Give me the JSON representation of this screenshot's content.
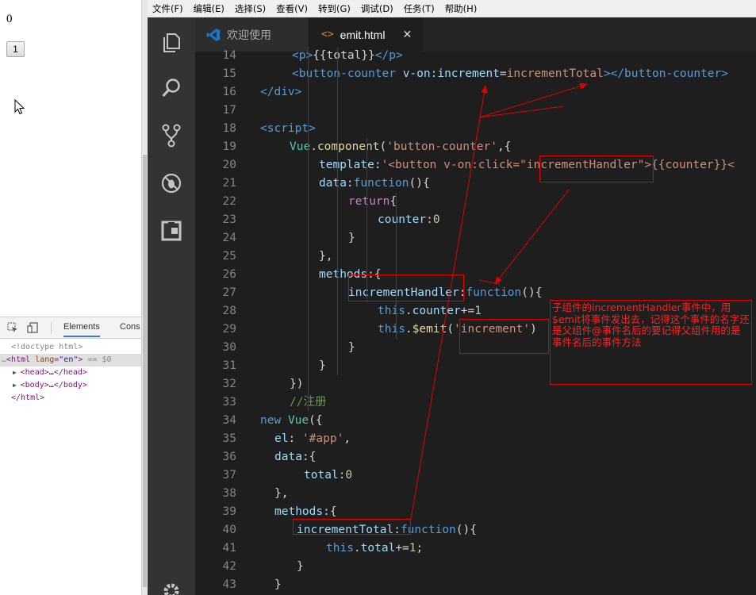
{
  "browser": {
    "total": "0",
    "counter_button": "1"
  },
  "devtools": {
    "tabs": [
      "Elements",
      "Cons"
    ],
    "lines": [
      {
        "text": "<!doctype html>"
      },
      {
        "text": "<html lang=\"en\"> == $0"
      },
      {
        "text": "<head>…</head>"
      },
      {
        "text": "<body>…</body>"
      },
      {
        "text": "</html>"
      }
    ]
  },
  "editor": {
    "menu": [
      "文件(F)",
      "编辑(E)",
      "选择(S)",
      "查看(V)",
      "转到(G)",
      "调试(D)",
      "任务(T)",
      "帮助(H)"
    ],
    "tabs": {
      "welcome": "欢迎使用",
      "emit": "emit.html",
      "close": "✕"
    },
    "activity_icons": [
      "explorer-icon",
      "search-icon",
      "source-control-icon",
      "debug-icon",
      "extensions-icon",
      "gear-icon"
    ],
    "line_numbers": [
      "14",
      "15",
      "16",
      "17",
      "18",
      "19",
      "20",
      "21",
      "22",
      "23",
      "24",
      "25",
      "26",
      "27",
      "28",
      "29",
      "30",
      "31",
      "32",
      "33",
      "34",
      "35",
      "36",
      "37",
      "38",
      "39",
      "40",
      "41",
      "42",
      "43"
    ],
    "code": {
      "l14": [
        "<p>",
        "{{total}}",
        "</p>"
      ],
      "l15": [
        "<button-counter ",
        "v-on:increment",
        "=",
        "incrementTotal",
        "></button-counter>"
      ],
      "l16": [
        "</div>"
      ],
      "l18": [
        "<script>"
      ],
      "l19": [
        "Vue",
        ".",
        "component",
        "(",
        "'button-counter'",
        ",{"
      ],
      "l20": [
        "template",
        ":",
        "'<button v-on:click=\"",
        "incrementHandler",
        "\">{{counter}}<"
      ],
      "l21": [
        "data",
        ":",
        "function",
        "(){"
      ],
      "l22": [
        "return",
        "{"
      ],
      "l23": [
        "counter",
        ":",
        "0"
      ],
      "l24": [
        "}"
      ],
      "l25": [
        "},"
      ],
      "l26": [
        "methods",
        ":{"
      ],
      "l27": [
        "incrementHandler",
        ":",
        "function",
        "(){"
      ],
      "l28": [
        "this",
        ".",
        "counter",
        "+=",
        "1"
      ],
      "l29": [
        "this",
        ".",
        "$emit",
        "(",
        "'increment'",
        ")"
      ],
      "l30": [
        "}"
      ],
      "l31": [
        "}"
      ],
      "l32": [
        "})"
      ],
      "l33": [
        "//注册"
      ],
      "l34": [
        "new",
        " ",
        "Vue",
        "({"
      ],
      "l35": [
        "el",
        ": ",
        "'#app'",
        ","
      ],
      "l36": [
        "data",
        ":{"
      ],
      "l37": [
        "total",
        ":",
        "0"
      ],
      "l38": [
        "},"
      ],
      "l39": [
        "methods",
        ":{"
      ],
      "l40": [
        "incrementTotal",
        ":",
        "function",
        "(){"
      ],
      "l41": [
        "this",
        ".",
        "total",
        "+=",
        "1",
        ";"
      ],
      "l42": [
        "}"
      ],
      "l43": [
        "}"
      ]
    },
    "annotation": "子组件的incrementHandler事件中，用$emit将事件发出去，记得这个事件的名字还是父组件@事件名后的要记得父组件用的是事件名后的事件方法"
  },
  "colors": {
    "annotation_red": "#e00000",
    "editor_bg": "#1e1e1e",
    "activity_bg": "#333333",
    "tab_bar_bg": "#252526"
  }
}
